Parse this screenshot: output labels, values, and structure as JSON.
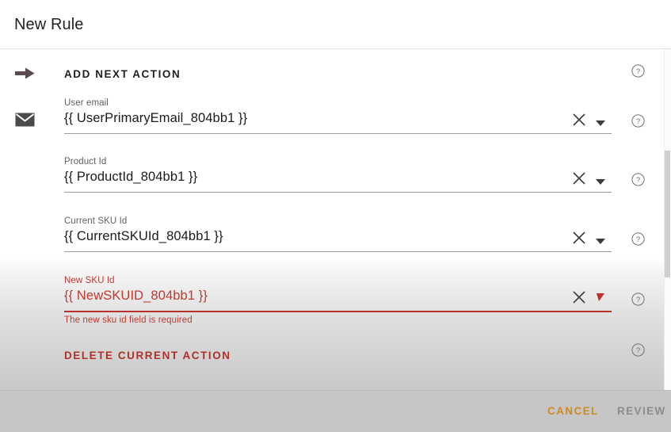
{
  "window": {
    "title": "New Rule"
  },
  "add_action": {
    "label": "ADD NEXT ACTION",
    "icon": "arrow-right-icon"
  },
  "fields": [
    {
      "label": "User email",
      "value": "{{ UserPrimaryEmail_804bb1 }}",
      "gutter_icon": "envelope-icon",
      "clear_icon": "clear-x-icon",
      "dropdown_icon": "chevron-down-icon",
      "error": false,
      "hint": ""
    },
    {
      "label": "Product Id",
      "value": "{{ ProductId_804bb1 }}",
      "gutter_icon": "",
      "clear_icon": "clear-x-icon",
      "dropdown_icon": "chevron-down-icon",
      "error": false,
      "hint": ""
    },
    {
      "label": "Current SKU Id",
      "value": "{{ CurrentSKUId_804bb1 }}",
      "gutter_icon": "",
      "clear_icon": "clear-x-icon",
      "dropdown_icon": "chevron-down-icon",
      "error": false,
      "hint": ""
    },
    {
      "label": "New SKU Id",
      "value": "{{ NewSKUID_804bb1 }}",
      "gutter_icon": "",
      "clear_icon": "clear-x-icon",
      "dropdown_icon": "chevron-down-icon",
      "error": true,
      "hint": "The new sku id field is required"
    }
  ],
  "delete_action": {
    "label": "DELETE CURRENT ACTION"
  },
  "help_icons": {
    "name": "help-circle-icon",
    "glyph": "?",
    "count": 6
  },
  "footer": {
    "cancel_label": "CANCEL",
    "review_label": "REVIEW"
  },
  "colors": {
    "accent_cancel": "#d08a22",
    "error": "#c0392f",
    "delete_action": "#b0302a",
    "disabled": "#8c8c8c",
    "title_text": "#222222",
    "label_text": "#5f5f5f",
    "value_text": "#1b1b1b",
    "underline": "#9e9e9e",
    "footer_bg": "#c6c6c6"
  }
}
